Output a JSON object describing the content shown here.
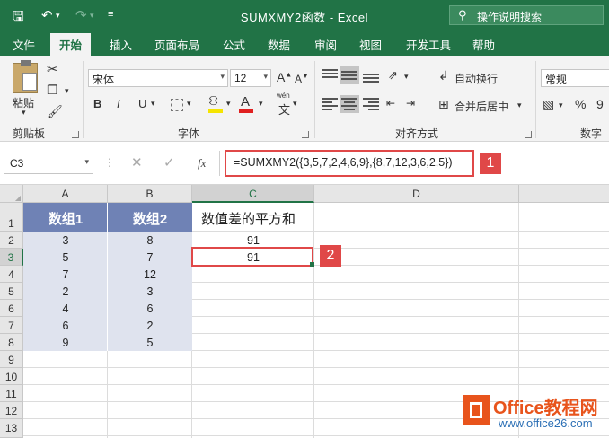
{
  "window": {
    "title": "SUMXMY2函数  -  Excel",
    "tell_me": "操作说明搜索"
  },
  "tabs": [
    "文件",
    "开始",
    "插入",
    "页面布局",
    "公式",
    "数据",
    "审阅",
    "视图",
    "开发工具",
    "帮助"
  ],
  "ribbon": {
    "paste": "粘贴",
    "clipboard": "剪贴板",
    "font_name": "宋体",
    "font_size": "12",
    "font_group": "字体",
    "bold": "B",
    "italic": "I",
    "underline": "U",
    "font_color_letter": "A",
    "wen": "wén",
    "wrap_text": "自动换行",
    "merge_center": "合并后居中",
    "align_group": "对齐方式",
    "number_format": "常规",
    "percent": "%",
    "comma": "9",
    "number_group": "数字"
  },
  "formula_bar": {
    "name_box": "C3",
    "fx": "fx",
    "formula": "=SUMXMY2({3,5,7,2,4,6,9},{8,7,12,3,6,2,5})"
  },
  "callouts": [
    "1",
    "2"
  ],
  "grid": {
    "columns": [
      "A",
      "B",
      "C",
      "D"
    ],
    "rows": [
      "1",
      "2",
      "3",
      "4",
      "5",
      "6",
      "7",
      "8",
      "9",
      "10",
      "11",
      "12",
      "13"
    ],
    "header": {
      "a": "数组1",
      "b": "数组2",
      "c": "数值差的平方和"
    },
    "col_a": [
      "3",
      "5",
      "7",
      "2",
      "4",
      "6",
      "9"
    ],
    "col_b": [
      "8",
      "7",
      "12",
      "3",
      "6",
      "2",
      "5"
    ],
    "col_c": [
      "91",
      "91"
    ]
  },
  "watermark": {
    "brand": "Office教程网",
    "url": "www.office26.com"
  },
  "colors": {
    "excel_green": "#217346",
    "highlight_red": "#e04848",
    "header_fill": "#6f82b5",
    "data_fill": "#dfe3ee"
  }
}
